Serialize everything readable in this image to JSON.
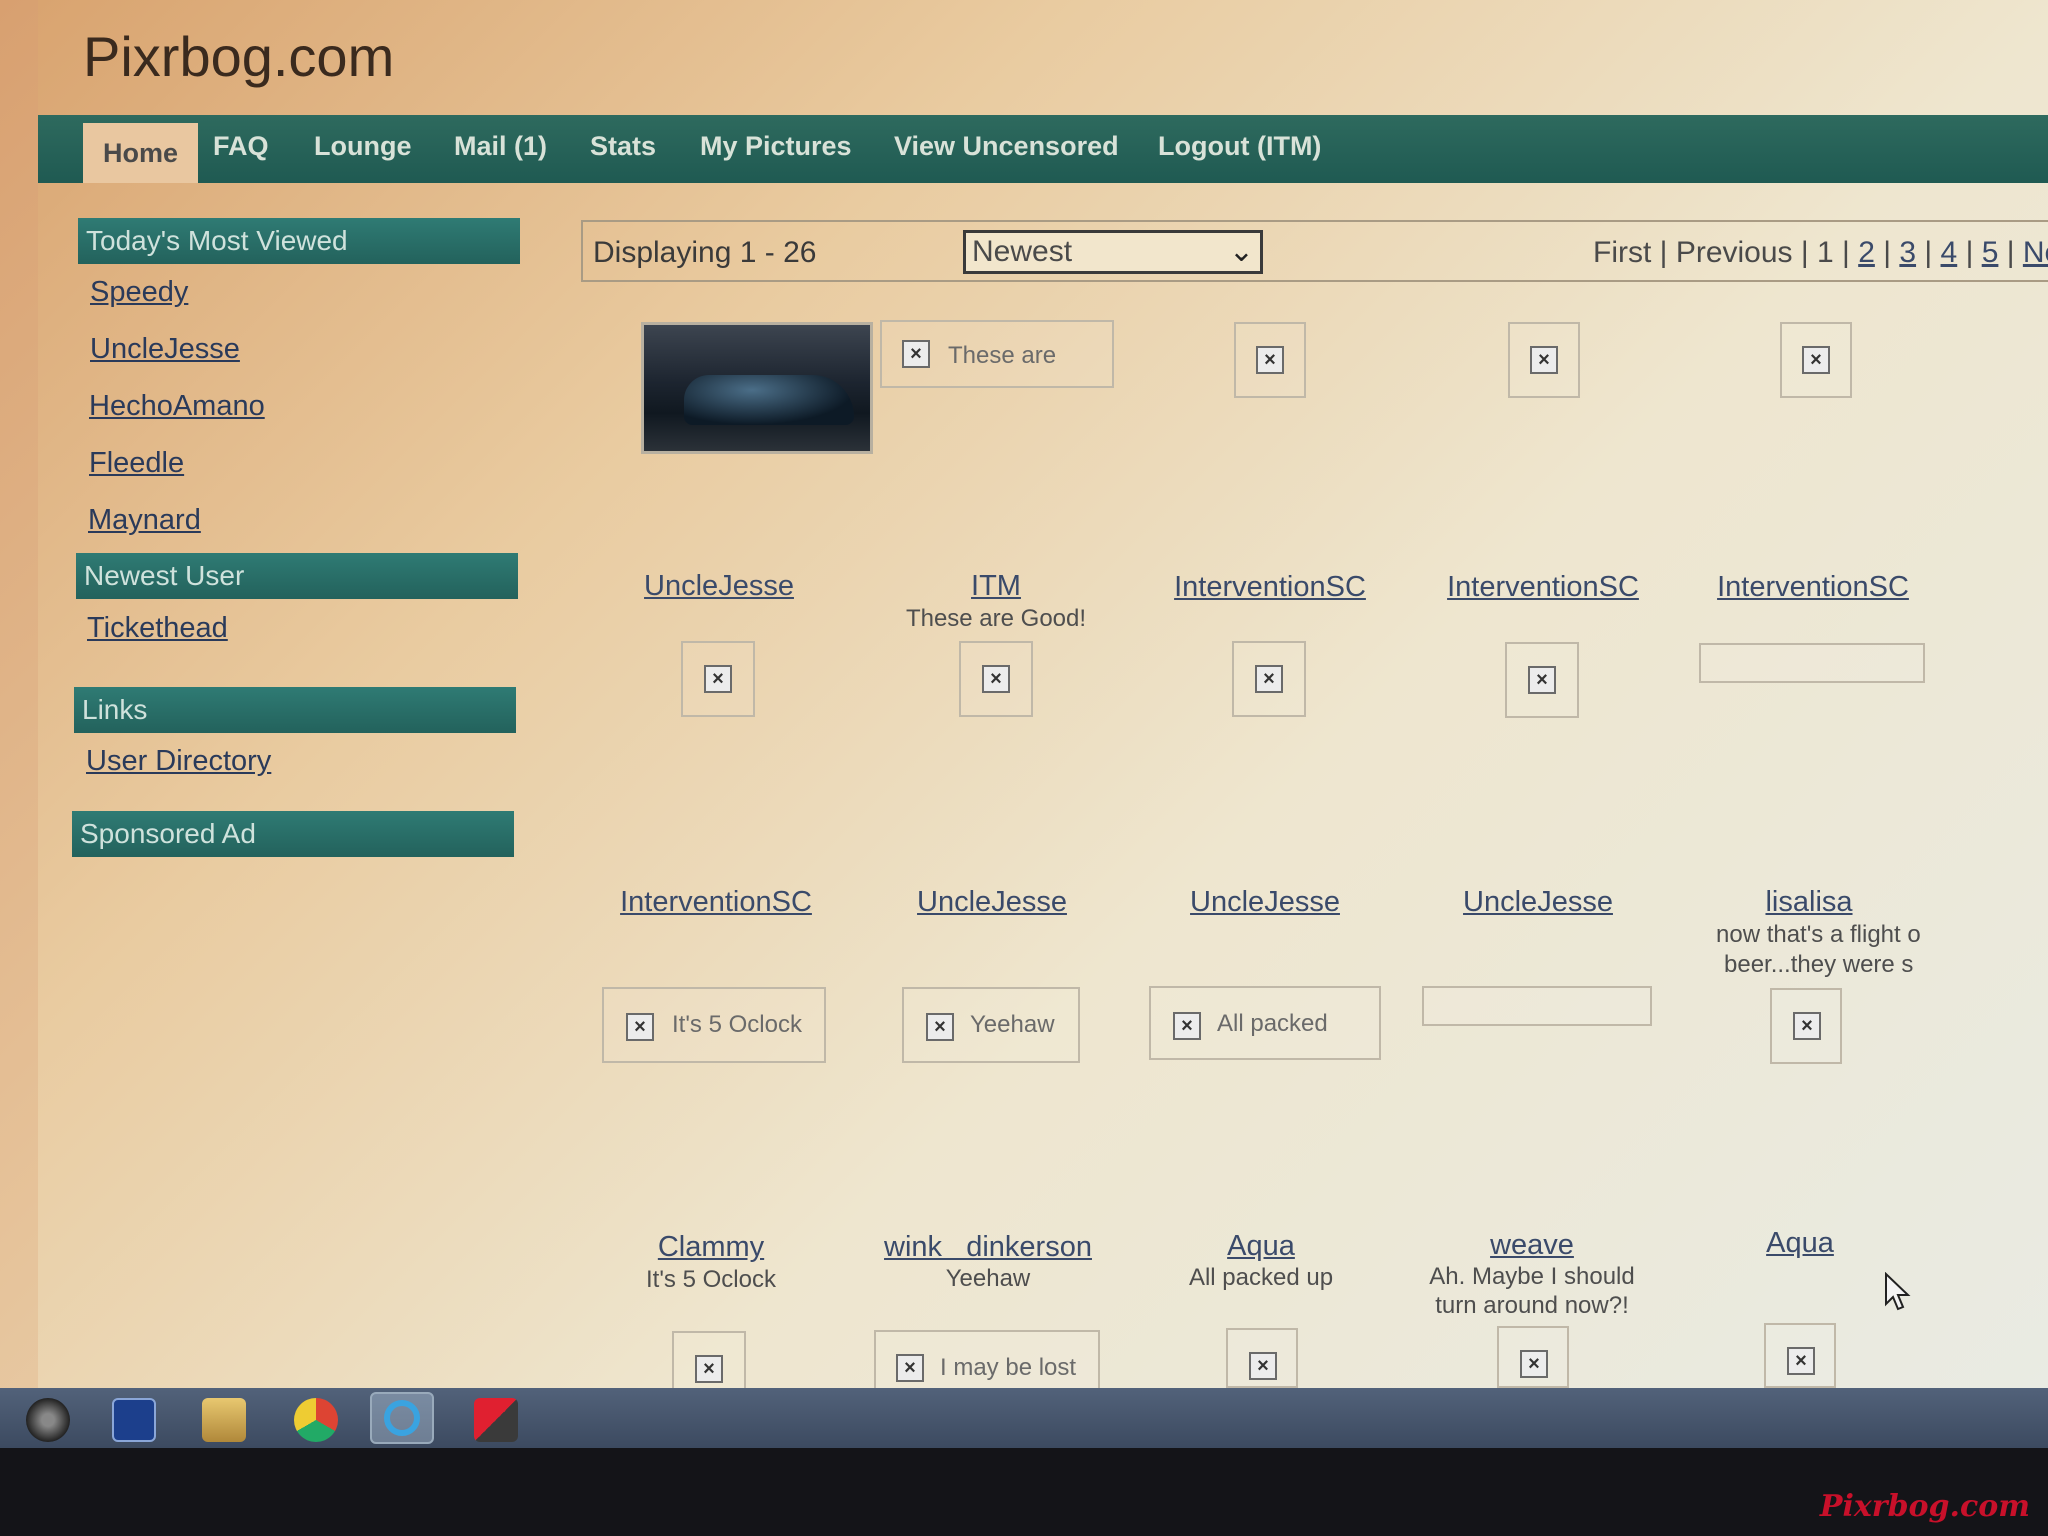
{
  "site": {
    "title": "Pixrbog.com"
  },
  "nav": {
    "home": "Home",
    "faq": "FAQ",
    "lounge": "Lounge",
    "mail": "Mail (1)",
    "stats": "Stats",
    "my_pictures": "My Pictures",
    "view_uncensored": "View Uncensored",
    "logout": "Logout (ITM)"
  },
  "sidebar": {
    "most_viewed_title": "Today's Most Viewed",
    "most_viewed": [
      "Speedy",
      "UncleJesse",
      "HechoAmano",
      "Fleedle",
      "Maynard"
    ],
    "newest_user_title": "Newest User",
    "newest_user": "Tickethead",
    "links_title": "Links",
    "user_directory": "User Directory",
    "sponsored_title": "Sponsored Ad"
  },
  "controls": {
    "displaying": "Displaying 1 - 26",
    "sort_selected": "Newest",
    "pager": {
      "first": "First",
      "previous": "Previous",
      "current": "1",
      "pages": [
        "2",
        "3",
        "4",
        "5"
      ],
      "next": "Next",
      "sep": "|"
    }
  },
  "grid": {
    "row1": [
      {
        "alt": "These are"
      },
      {},
      {},
      {}
    ],
    "row2": [
      {
        "user": "UncleJesse",
        "caption": ""
      },
      {
        "user": "ITM",
        "caption": "These are Good!"
      },
      {
        "user": "InterventionSC",
        "caption": ""
      },
      {
        "user": "InterventionSC",
        "caption": ""
      },
      {
        "user": "InterventionSC",
        "caption": ""
      }
    ],
    "row3_alts": [
      "It's 5 Oclock",
      "Yeehaw",
      "All packed"
    ],
    "row3": [
      {
        "user": "InterventionSC",
        "caption": ""
      },
      {
        "user": "UncleJesse",
        "caption": ""
      },
      {
        "user": "UncleJesse",
        "caption": ""
      },
      {
        "user": "UncleJesse",
        "caption": ""
      },
      {
        "user": "lisalisa",
        "caption_line1": "now that's a flight o",
        "caption_line2": "beer...they were s"
      }
    ],
    "row4": [
      {
        "user": "Clammy",
        "caption": "It's 5 Oclock"
      },
      {
        "user": "wink   dinkerson",
        "caption": "Yeehaw"
      },
      {
        "user": "Aqua",
        "caption": "All packed up"
      },
      {
        "user": "weave",
        "caption_line1": "Ah. Maybe I should",
        "caption_line2": "turn around now?!"
      },
      {
        "user": "Aqua",
        "caption": ""
      }
    ],
    "row4_alt": "I may be lost"
  },
  "watermark": "Pixrbog.com",
  "icons": {
    "broken_image": "broken-image-icon",
    "start": "start-icon",
    "weather": "weather-channel-icon",
    "folder": "folder-icon",
    "chrome": "chrome-icon",
    "ie": "internet-explorer-icon",
    "kaspersky": "kaspersky-icon",
    "cursor": "mouse-cursor-icon"
  }
}
